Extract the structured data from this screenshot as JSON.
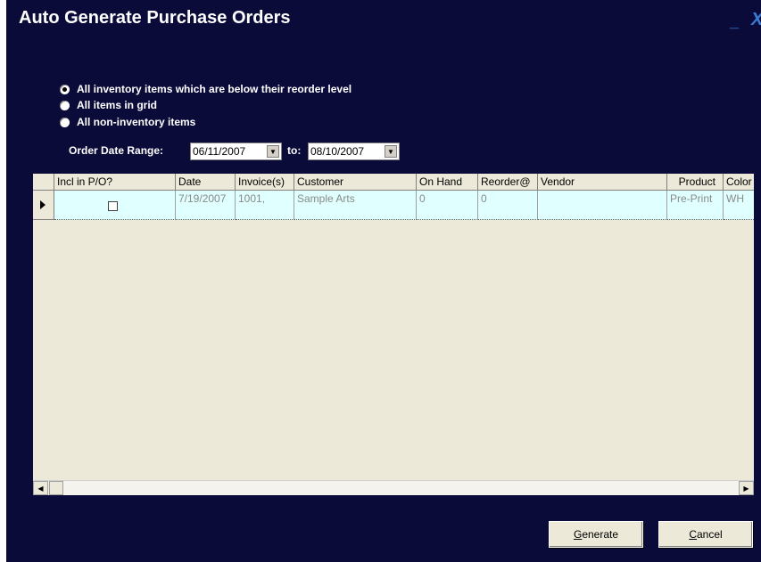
{
  "window": {
    "title": "Auto Generate Purchase Orders",
    "minimize_glyph": "_",
    "close_glyph": "X"
  },
  "options": [
    {
      "label": "All inventory items which are below their reorder level",
      "checked": true
    },
    {
      "label": "All items in grid",
      "checked": false
    },
    {
      "label": "All non-inventory items",
      "checked": false
    }
  ],
  "date_range": {
    "label": "Order Date Range:",
    "from": "06/11/2007",
    "to_label": "to:",
    "to": "08/10/2007"
  },
  "grid": {
    "columns": [
      "Incl in P/O?",
      "Date",
      "Invoice(s)",
      "Customer",
      "On Hand",
      "Reorder@",
      "Vendor",
      "Product",
      "Color"
    ],
    "rows": [
      {
        "incl": false,
        "date": "7/19/2007",
        "invoices": "1001,",
        "customer": "Sample Arts",
        "on_hand": "0",
        "reorder": "0",
        "vendor": "",
        "product": "Pre-Print",
        "color": "WH"
      }
    ]
  },
  "buttons": {
    "generate_label": "Generate",
    "cancel_label": "Cancel"
  },
  "colors": {
    "window_bg": "#0b0b3a",
    "grid_bg": "#ece9d8",
    "row_bg": "#e0ffff"
  }
}
